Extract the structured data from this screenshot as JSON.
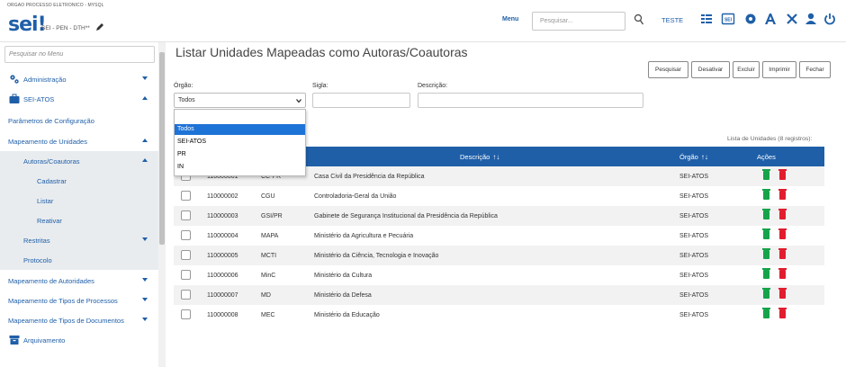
{
  "header": {
    "org": "ORGAO PROCESSO ELETRONICO - MYSQL",
    "logo": "sei",
    "logo_mark": "!",
    "env": "SEI - PEN - DTH**",
    "menu_label": "Menu",
    "search_placeholder": "Pesquisar...",
    "user": "TESTE",
    "icons": [
      "list-icon",
      "sei-icon",
      "pin-icon",
      "font-icon",
      "tools-icon",
      "user-icon",
      "power-icon"
    ],
    "accent": "#1f5fa8"
  },
  "sidebar": {
    "search_placeholder": "Pesquisar no Menu",
    "items": [
      {
        "label": "Administração",
        "icon": "gears-icon"
      },
      {
        "label": "SEI-ATOS",
        "icon": "briefcase-icon"
      },
      {
        "label": "Parâmetros de Configuração"
      },
      {
        "label": "Mapeamento de Unidades"
      },
      {
        "label": "Autoras/Coautoras"
      },
      {
        "label": "Cadastrar"
      },
      {
        "label": "Listar"
      },
      {
        "label": "Reativar"
      },
      {
        "label": "Restritas"
      },
      {
        "label": "Protocolo"
      },
      {
        "label": "Mapeamento de Autoridades"
      },
      {
        "label": "Mapeamento de Tipos de Processos"
      },
      {
        "label": "Mapeamento de Tipos de Documentos"
      },
      {
        "label": "Arquivamento",
        "icon": "archive-icon"
      }
    ]
  },
  "main": {
    "title": "Listar Unidades Mapeadas como Autoras/Coautoras",
    "buttons": [
      "Pesquisar",
      "Desativar",
      "Excluir",
      "Imprimir",
      "Fechar"
    ],
    "filters": {
      "orgao_label": "Órgão:",
      "orgao_value": "Todos",
      "sigla_label": "Sigla:",
      "descricao_label": "Descrição:"
    },
    "dropdown_options": [
      "Todos",
      "SEI-ATOS",
      "PR",
      "IN"
    ],
    "table_caption": "Lista de Unidades (8 registros):",
    "columns": {
      "descricao": "Descrição",
      "orgao": "Órgão",
      "acoes": "Ações"
    },
    "rows": [
      {
        "id": "110000001",
        "sigla": "CC-PR",
        "descricao": "Casa Civil da Presidência da República",
        "orgao": "SEI-ATOS"
      },
      {
        "id": "110000002",
        "sigla": "CGU",
        "descricao": "Controladoria-Geral da União",
        "orgao": "SEI-ATOS"
      },
      {
        "id": "110000003",
        "sigla": "GSI/PR",
        "descricao": "Gabinete de Segurança Institucional da Presidência da República",
        "orgao": "SEI-ATOS"
      },
      {
        "id": "110000004",
        "sigla": "MAPA",
        "descricao": "Ministério da Agricultura e Pecuária",
        "orgao": "SEI-ATOS"
      },
      {
        "id": "110000005",
        "sigla": "MCTI",
        "descricao": "Ministério da Ciência, Tecnologia e Inovação",
        "orgao": "SEI-ATOS"
      },
      {
        "id": "110000006",
        "sigla": "MinC",
        "descricao": "Ministério da Cultura",
        "orgao": "SEI-ATOS"
      },
      {
        "id": "110000007",
        "sigla": "MD",
        "descricao": "Ministério da Defesa",
        "orgao": "SEI-ATOS"
      },
      {
        "id": "110000008",
        "sigla": "MEC",
        "descricao": "Ministério da Educação",
        "orgao": "SEI-ATOS"
      }
    ],
    "action_icons": [
      "deactivate-icon",
      "delete-icon"
    ],
    "action_colors": {
      "deactivate": "#16a34a",
      "delete": "#e11d2e"
    },
    "dropdown_active_color": "#1e73d6"
  }
}
